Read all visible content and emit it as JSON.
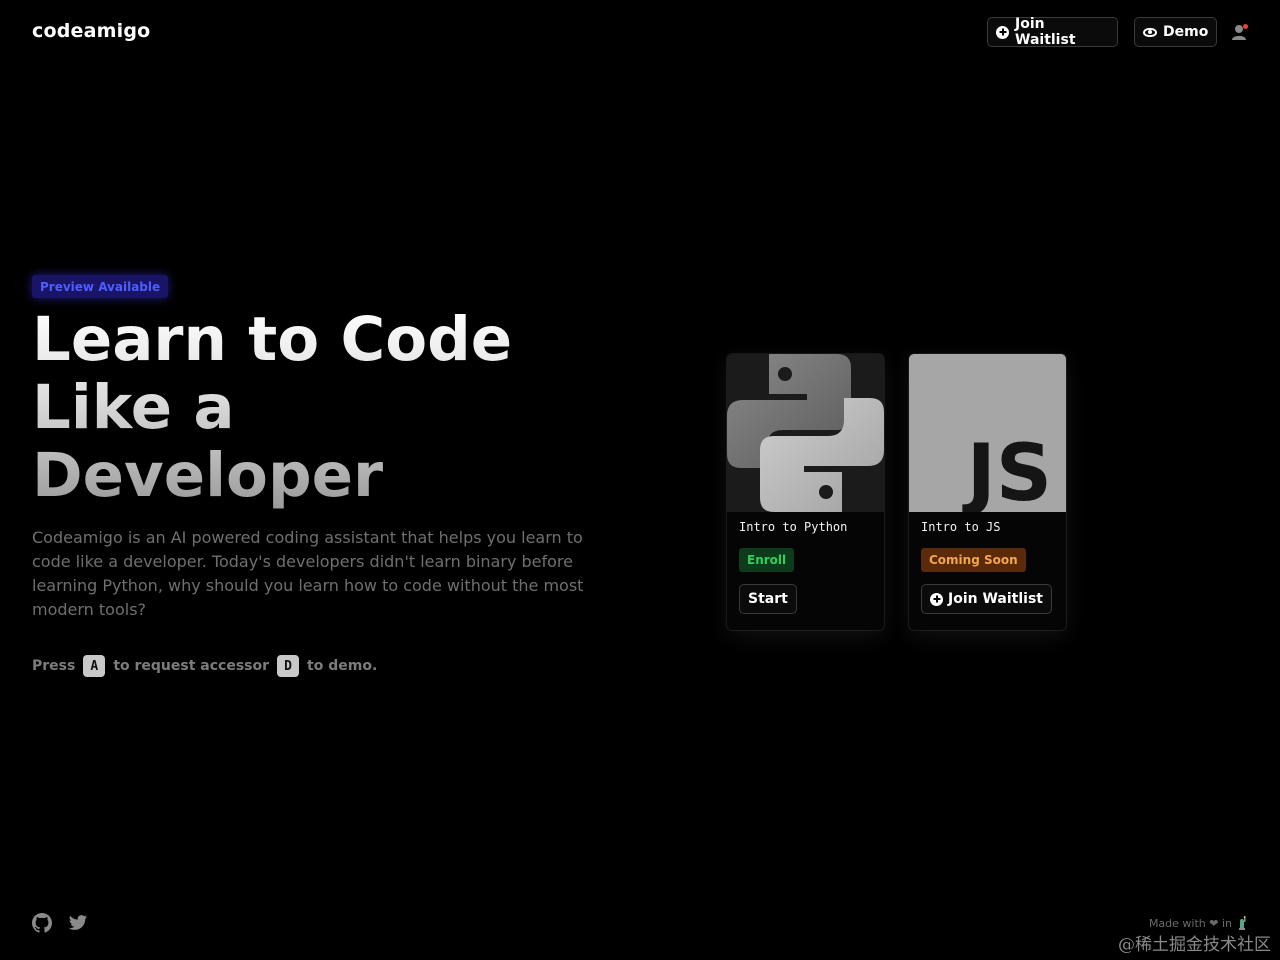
{
  "header": {
    "brand": "codeamigo",
    "waitlist_label": "Join Waitlist",
    "demo_label": "Demo"
  },
  "hero": {
    "badge": "Preview Available",
    "title_lines": [
      "Learn to Code",
      "Like a",
      "Developer"
    ],
    "description": "Codeamigo is an AI powered coding assistant that helps you learn to code like a developer. Today's developers didn't learn binary before learning Python, why should you learn how to code without the most modern tools?",
    "press": {
      "prefix": "Press",
      "key_a": "A",
      "middle": "to request accessor",
      "key_d": "D",
      "suffix": "to demo."
    }
  },
  "cards": [
    {
      "title": "Intro to Python",
      "status": "Enroll",
      "button": "Start",
      "icon": "python-logo"
    },
    {
      "title": "Intro to JS",
      "status": "Coming Soon",
      "button": "Join Waitlist",
      "icon": "js-logo",
      "logo_text": "JS"
    }
  ],
  "footer": {
    "made_with": "Made with ❤ in",
    "icons": [
      "github-icon",
      "twitter-icon"
    ],
    "watermark": "@稀土掘金技术社区"
  },
  "colors": {
    "background": "#000000",
    "badge_bg": "#1a1466",
    "badge_text": "#4d5dff",
    "enroll_bg": "#0e3b1b",
    "enroll_text": "#2fd15a",
    "soon_bg": "#5a2a0b",
    "soon_text": "#f3a64d"
  }
}
